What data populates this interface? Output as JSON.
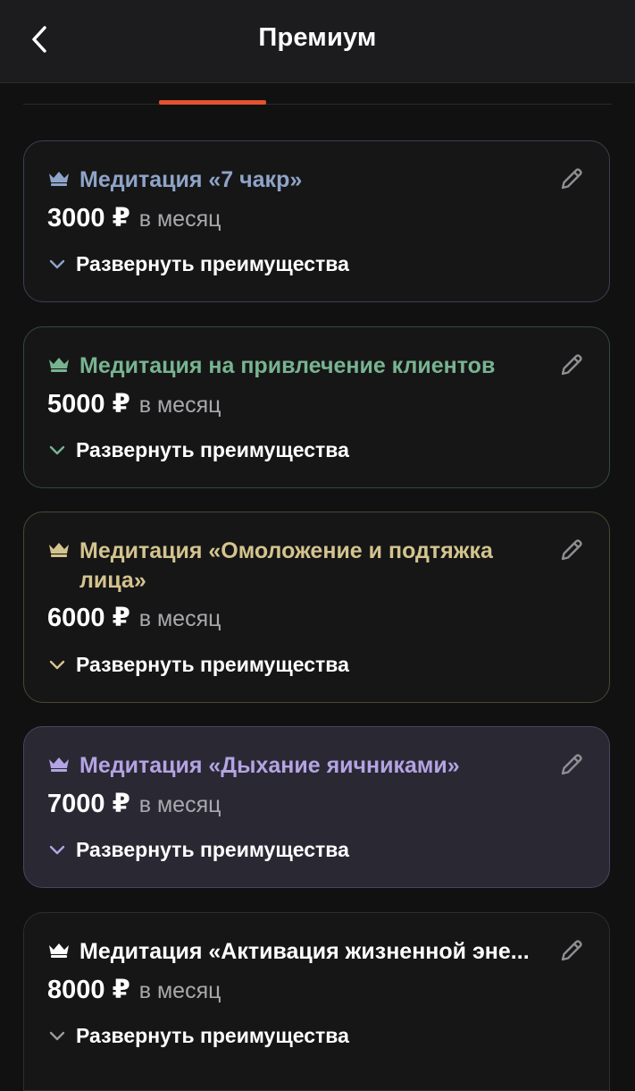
{
  "header": {
    "title": "Премиум"
  },
  "cards": [
    {
      "name": "Медитация «7 чакр»",
      "price": "3000 ₽",
      "period": "в месяц",
      "expand_label": "Развернуть преимущества",
      "accent": "#8ea4c8",
      "border": "#3a4150",
      "bg": "#161617"
    },
    {
      "name": "Медитация на привлечение клиентов",
      "price": "5000 ₽",
      "period": "в месяц",
      "expand_label": "Развернуть преимущества",
      "accent": "#78b490",
      "border": "#344a3d",
      "bg": "#161617"
    },
    {
      "name": "Медитация «Омоложение и подтяжка лица»",
      "price": "6000 ₽",
      "period": "в месяц",
      "expand_label": "Развернуть преимущества",
      "accent": "#d4c48e",
      "border": "#4d4633",
      "bg": "#161617"
    },
    {
      "name": "Медитация «Дыхание яичниками»",
      "price": "7000 ₽",
      "period": "в месяц",
      "expand_label": "Развернуть преимущества",
      "accent": "#b3a4e3",
      "border": "#4a4560",
      "bg": "#2a2833"
    },
    {
      "name": "Медитация «Активация жизненной эне...",
      "price": "8000 ₽",
      "period": "в месяц",
      "expand_label": "Развернуть преимущества",
      "accent": "#ffffff",
      "border": "#2e2e30",
      "bg": "#161617"
    }
  ]
}
